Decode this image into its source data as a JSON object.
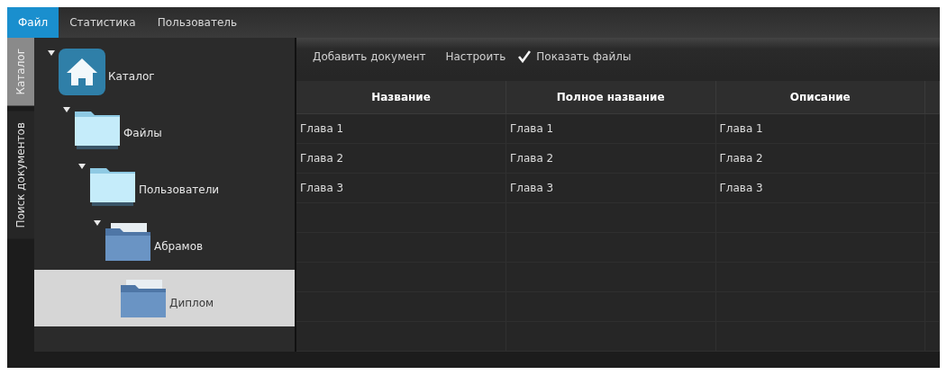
{
  "menu": [
    {
      "label": "Файл",
      "selected": true
    },
    {
      "label": "Статистика",
      "selected": false
    },
    {
      "label": "Пользователь",
      "selected": false
    }
  ],
  "side_tabs": [
    {
      "label": "Каталог",
      "selected": true
    },
    {
      "label": "Поиск документов",
      "selected": false
    }
  ],
  "tree": [
    {
      "label": "Каталог",
      "kind": "home",
      "expanded": true,
      "selected": false,
      "children": [
        {
          "label": "Файлы",
          "kind": "folder-light",
          "expanded": true,
          "selected": false,
          "children": [
            {
              "label": "Пользователи",
              "kind": "folder-light",
              "expanded": true,
              "selected": false,
              "children": [
                {
                  "label": "Абрамов",
                  "kind": "folder-dark",
                  "expanded": true,
                  "selected": false,
                  "children": [
                    {
                      "label": "Диплом",
                      "kind": "folder-dark",
                      "selected": true
                    }
                  ]
                }
              ]
            }
          ]
        }
      ]
    }
  ],
  "toolbar": {
    "buttons": [
      "Добавить документ",
      "Настроить"
    ],
    "show_files": {
      "label": "Показать файлы",
      "checked": true
    }
  },
  "table": {
    "columns": [
      "Название",
      "Полное название",
      "Описание"
    ],
    "rows": [
      [
        "Глава 1",
        "Глава 1",
        "Глава 1"
      ],
      [
        "Глава 2",
        "Глава 2",
        "Глава 2"
      ],
      [
        "Глава 3",
        "Глава 3",
        "Глава 3"
      ]
    ]
  }
}
